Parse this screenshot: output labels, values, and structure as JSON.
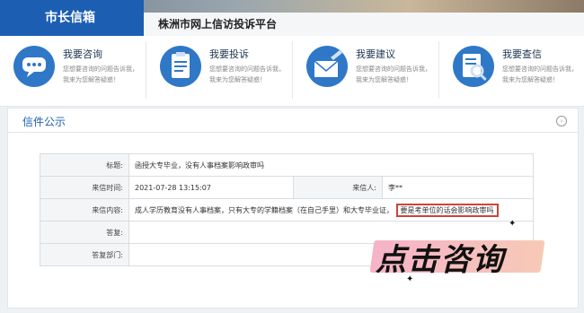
{
  "header": {
    "active_tab": "市长信箱",
    "platform_title": "株洲市网上信访投诉平台"
  },
  "services": [
    {
      "title": "我要咨询",
      "desc": "您想要咨询的问题告诉我，我来为您解答疑惑！",
      "icon": "chat-bubble-icon"
    },
    {
      "title": "我要投诉",
      "desc": "您想要咨询的问题告诉我，我来为您解答疑惑！",
      "icon": "clipboard-icon"
    },
    {
      "title": "我要建议",
      "desc": "您想要咨询的问题告诉我，我来为您解答疑惑！",
      "icon": "envelope-pen-icon"
    },
    {
      "title": "我要查信",
      "desc": "您想要咨询的问题告诉我，我来为您解答疑惑！",
      "icon": "search-document-icon"
    }
  ],
  "panel": {
    "title": "信件公示",
    "more_glyph": "›"
  },
  "letter": {
    "subject_label": "标题:",
    "subject": "函授大专毕业，没有人事档案影响政审吗",
    "time_label": "来信时间:",
    "time": "2021-07-28 13:15:07",
    "sender_label": "来信人:",
    "sender": "李**",
    "content_label": "来信内容:",
    "content": "成人学历教育没有人事档案，只有大专的学籍档案（在自己手里）和大专毕业证，",
    "content_highlight": "要是考单位的话会影响政审吗",
    "reply_label": "答复:",
    "reply": "",
    "dept_label": "答复部门:",
    "dept": ""
  },
  "overlay": {
    "cta": "点击咨询"
  }
}
